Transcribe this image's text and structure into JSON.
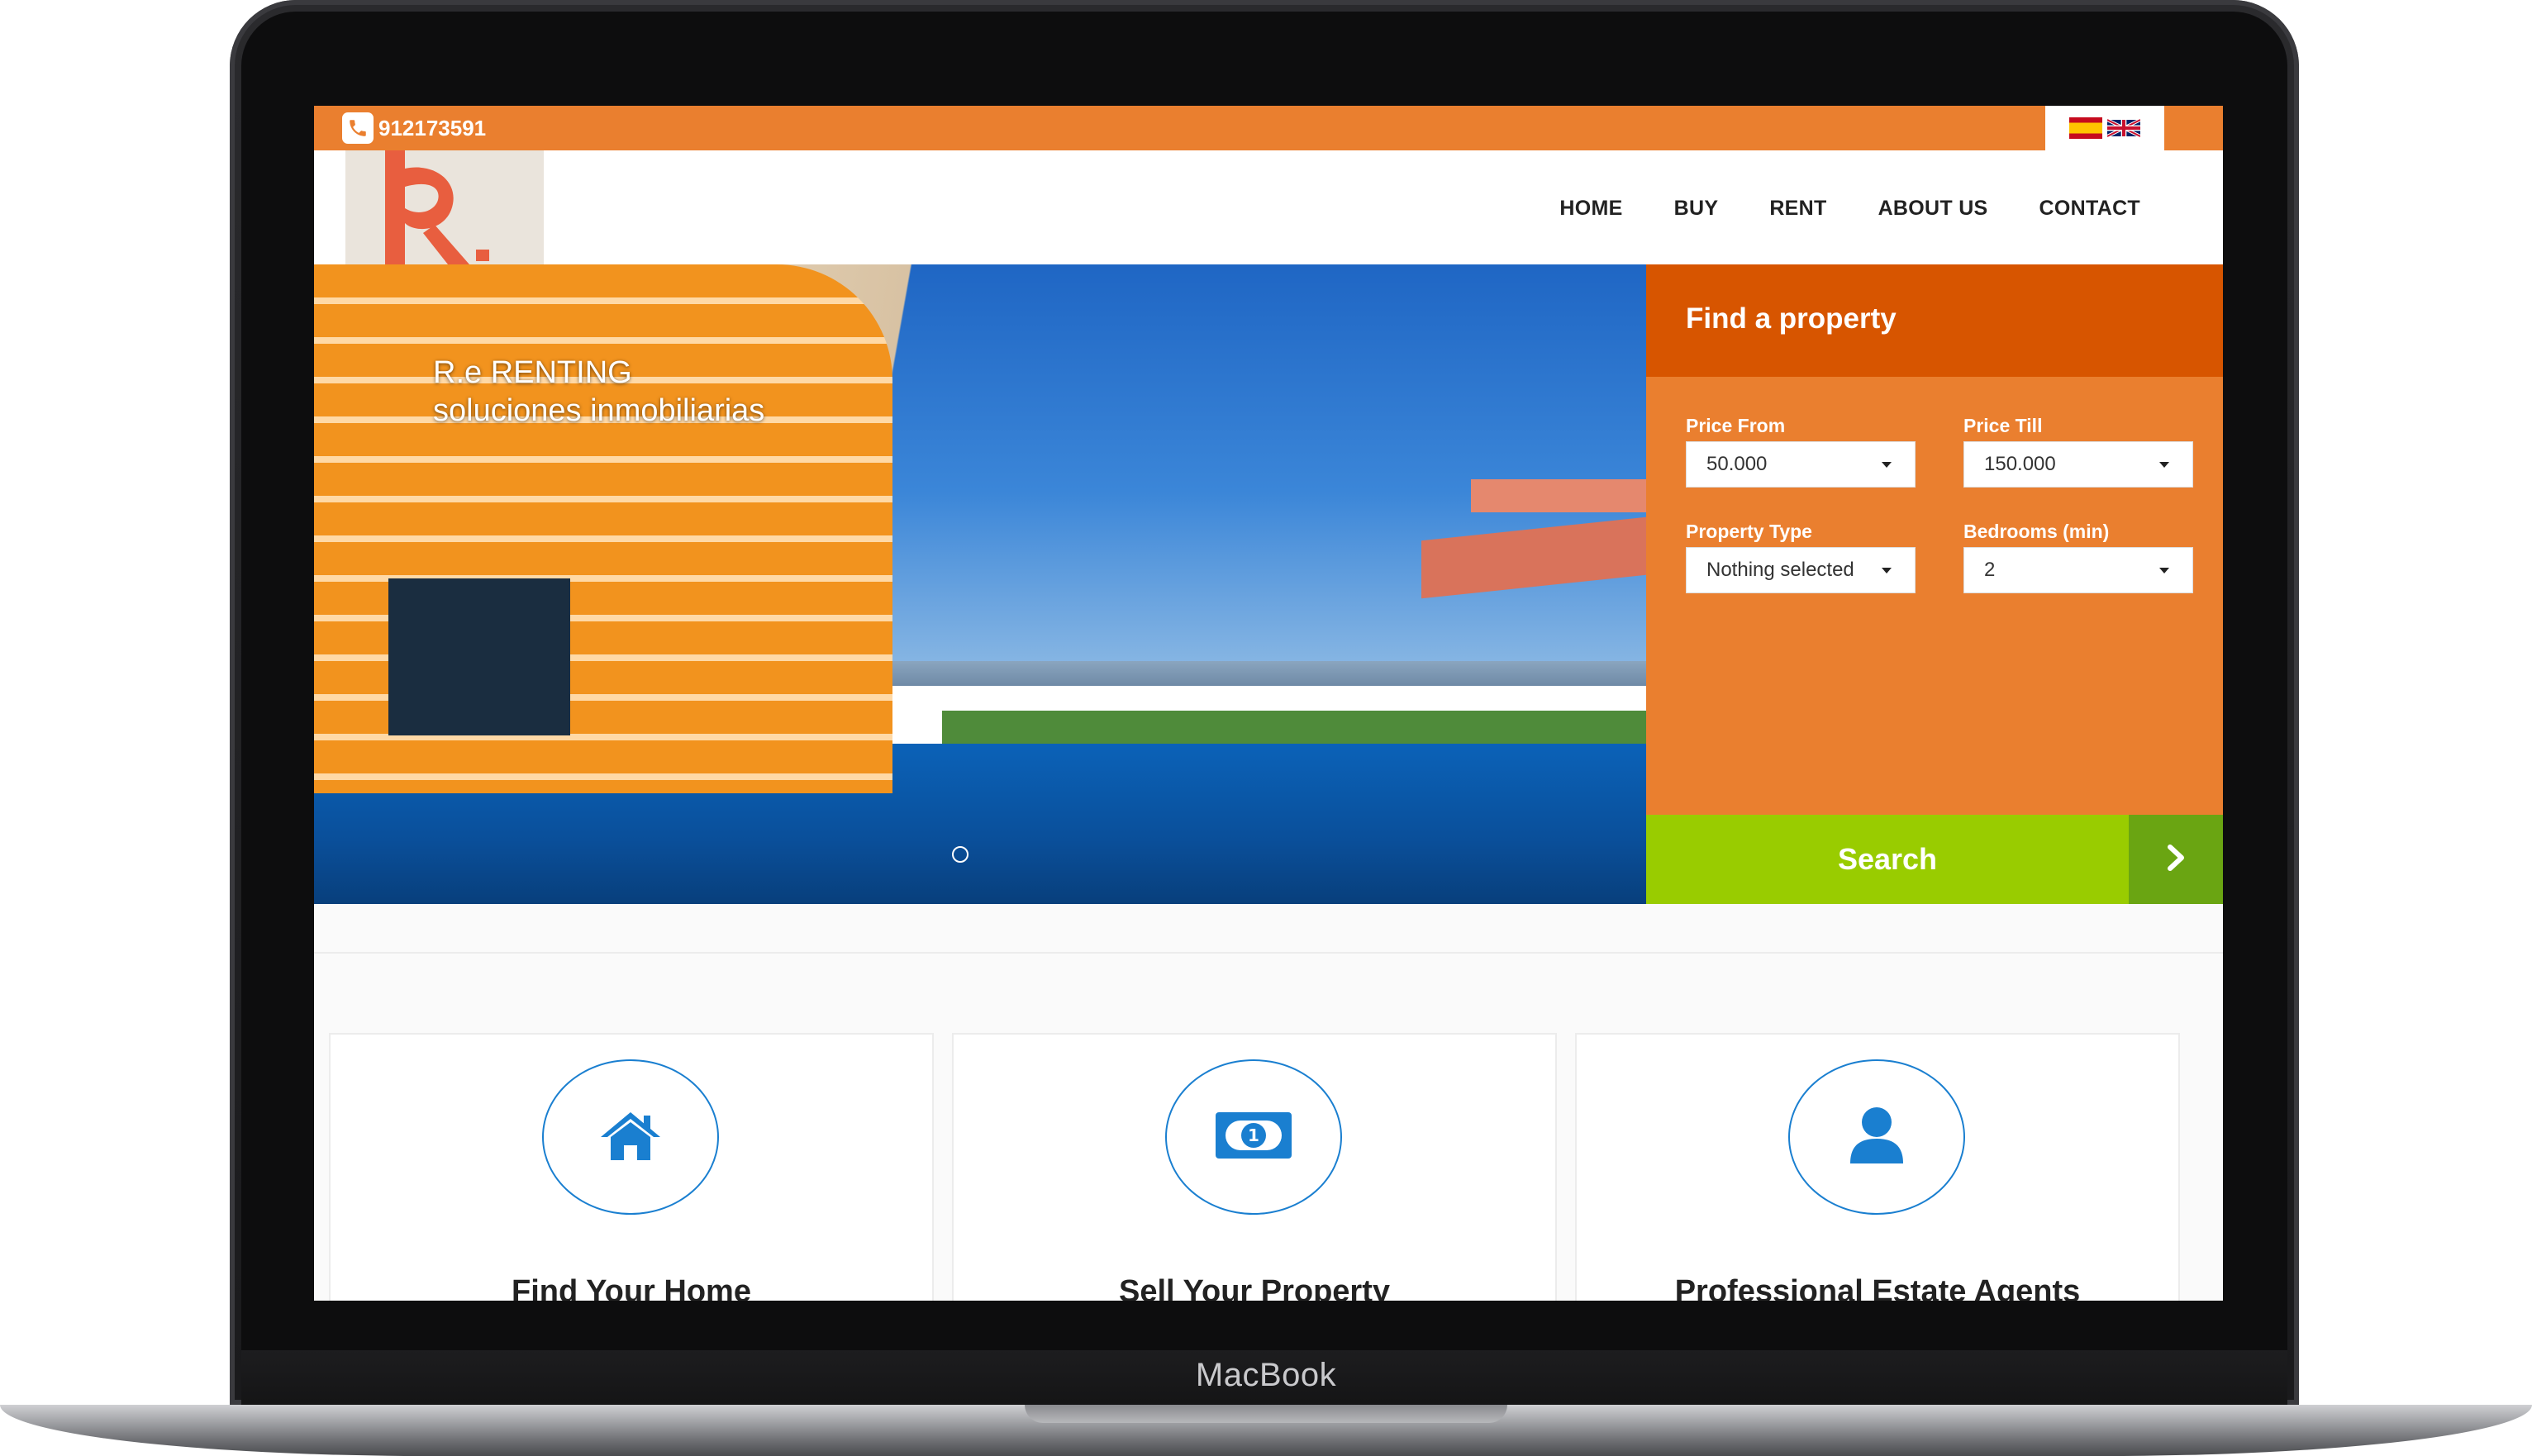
{
  "device": {
    "brand_label": "MacBook"
  },
  "topbar": {
    "phone_icon": "phone-icon",
    "phone_number": "912173591",
    "languages": [
      {
        "code": "es",
        "icon": "spain-flag-icon"
      },
      {
        "code": "en",
        "icon": "uk-flag-icon"
      }
    ],
    "accent_color": "#ea7f2f"
  },
  "nav": {
    "items": [
      {
        "label": "HOME"
      },
      {
        "label": "BUY"
      },
      {
        "label": "RENT"
      },
      {
        "label": "ABOUT US"
      },
      {
        "label": "CONTACT"
      }
    ]
  },
  "hero": {
    "caption_line1": "R.e RENTING",
    "caption_line2": "soluciones inmobiliarias",
    "slide_indicator_count": 1
  },
  "search": {
    "title": "Find a property",
    "price_from": {
      "label": "Price From",
      "value": "50.000"
    },
    "price_till": {
      "label": "Price Till",
      "value": "150.000"
    },
    "property_type": {
      "label": "Property Type",
      "value": "Nothing selected"
    },
    "bedrooms": {
      "label": "Bedrooms (min)",
      "value": "2"
    },
    "button_label": "Search",
    "button_color": "#99cc00"
  },
  "features": [
    {
      "icon": "home-icon",
      "title": "Find Your Home"
    },
    {
      "icon": "money-bill-icon",
      "title": "Sell Your Property"
    },
    {
      "icon": "user-icon",
      "title": "Professional Estate Agents"
    }
  ]
}
